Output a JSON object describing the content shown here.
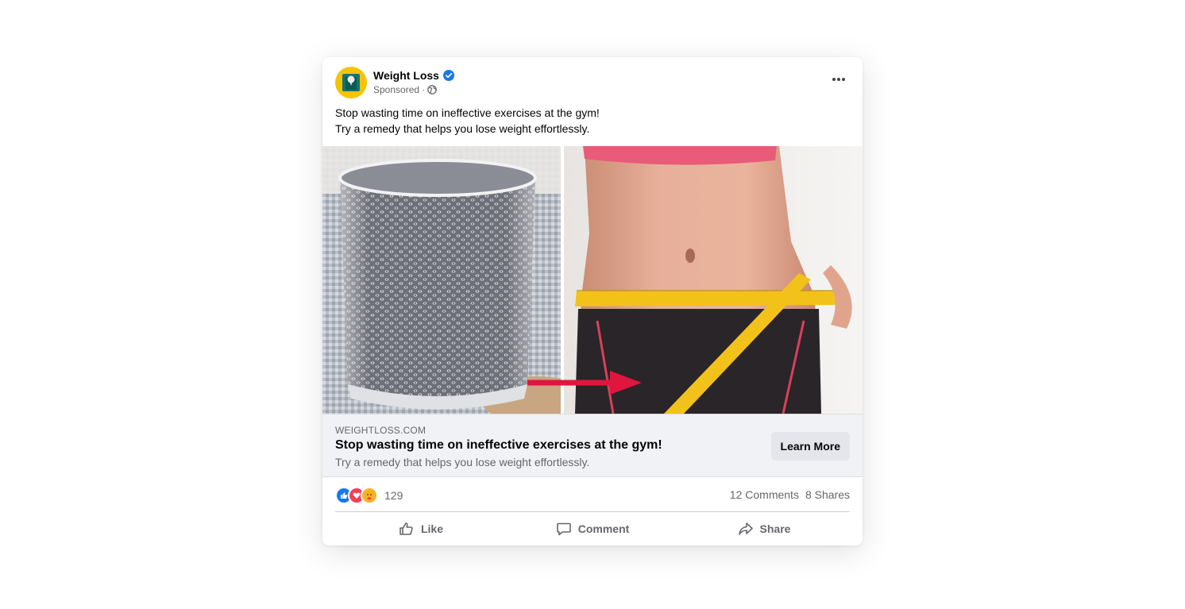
{
  "post": {
    "page_name": "Weight Loss",
    "sponsored_label": "Sponsored",
    "meta_separator": "·",
    "text_line_1": "Stop wasting time on ineffective exercises at the gym!",
    "text_line_2": "Try a remedy that helps you lose weight effortlessly.",
    "avatar_color": "#f5c400",
    "verified_color": "#1877f2"
  },
  "link_preview": {
    "domain": "WEIGHTLOSS.COM",
    "title": "Stop wasting time on ineffective exercises at the gym!",
    "description": "Try a remedy that helps you lose weight effortlessly.",
    "cta_label": "Learn More"
  },
  "stats": {
    "reactions": [
      "like",
      "love",
      "care"
    ],
    "reaction_count": "129",
    "comments": "12 Comments",
    "shares": "8 Shares"
  },
  "actions": {
    "like_label": "Like",
    "comment_label": "Comment",
    "share_label": "Share"
  },
  "icons": {
    "more": "more-horizontal-icon",
    "globe": "globe-icon",
    "verified": "verified-badge-icon",
    "like": "thumbs-up-icon",
    "comment": "comment-bubble-icon",
    "share": "share-arrow-icon"
  }
}
